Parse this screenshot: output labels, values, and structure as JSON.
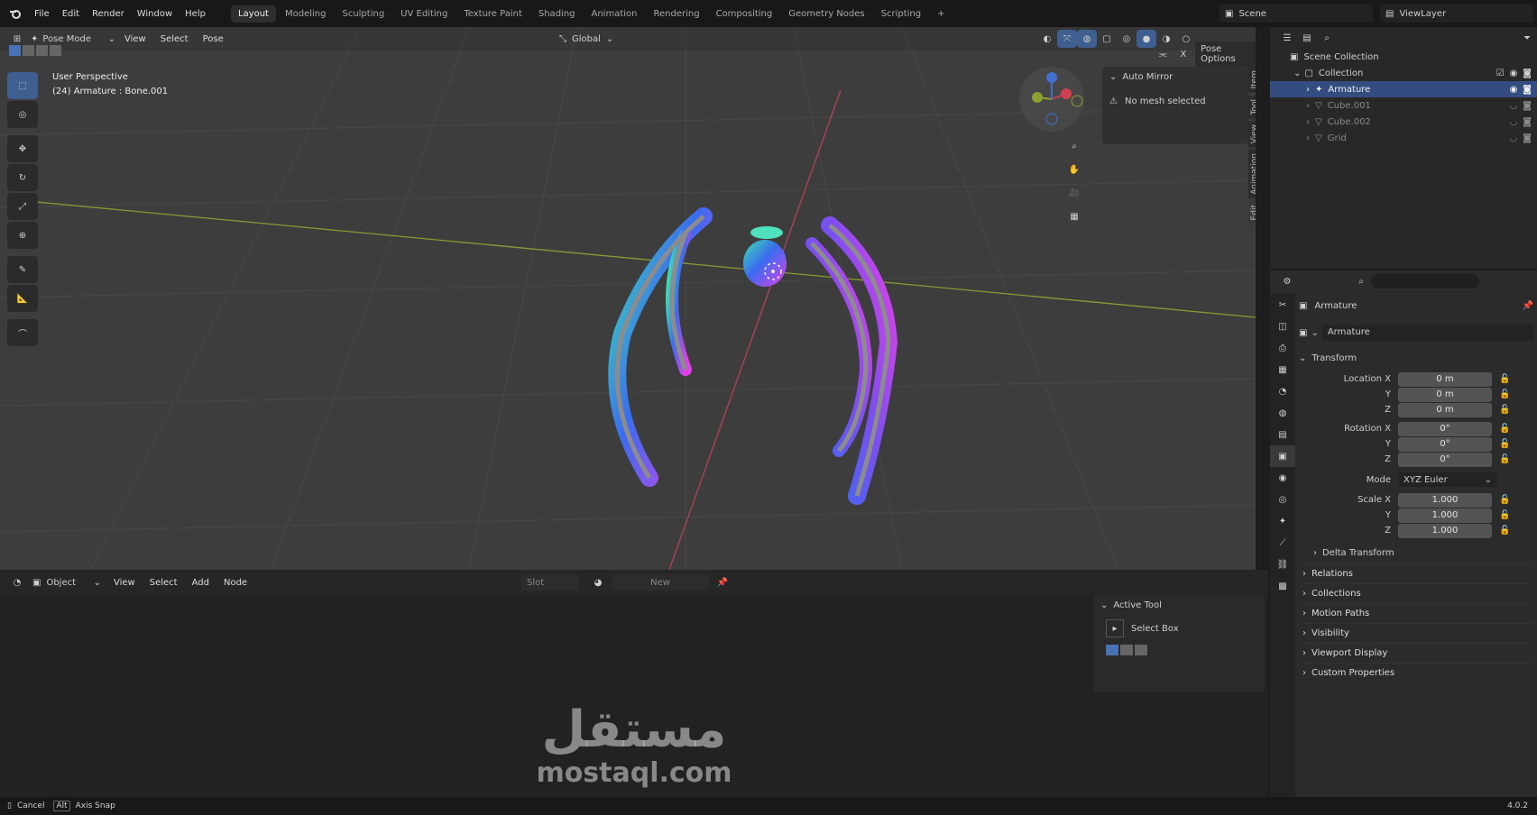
{
  "app": {
    "version": "4.0.2"
  },
  "topbar": {
    "menus": [
      "File",
      "Edit",
      "Render",
      "Window",
      "Help"
    ],
    "workspaces": [
      "Layout",
      "Modeling",
      "Sculpting",
      "UV Editing",
      "Texture Paint",
      "Shading",
      "Animation",
      "Rendering",
      "Compositing",
      "Geometry Nodes",
      "Scripting"
    ],
    "active_workspace": "Layout",
    "scene": "Scene",
    "view_layer": "ViewLayer"
  },
  "viewport": {
    "mode": "Pose Mode",
    "menus": [
      "View",
      "Select",
      "Pose"
    ],
    "orientation": "Global",
    "overlay_title": "User Perspective",
    "overlay_sub": "(24) Armature : Bone.001",
    "pose_options": "Pose Options",
    "auto_mirror": "Auto Mirror",
    "no_mesh": "No mesh selected",
    "side_tabs": [
      "Item",
      "Tool",
      "View",
      "Animation",
      "Edit"
    ]
  },
  "bottom_editor": {
    "object": "Object",
    "menus": [
      "View",
      "Select",
      "Add",
      "Node"
    ],
    "slot": "Slot",
    "new": "New",
    "active_tool": "Active Tool",
    "select_box": "Select Box"
  },
  "status": {
    "cancel": "Cancel",
    "alt": "Alt",
    "axis_snap": "Axis Snap"
  },
  "outliner": {
    "scene_collection": "Scene Collection",
    "collection": "Collection",
    "items": [
      "Armature",
      "Cube.001",
      "Cube.002",
      "Grid"
    ]
  },
  "properties": {
    "object_name": "Armature",
    "data_name": "Armature",
    "transform": "Transform",
    "location_label": "Location X",
    "location": [
      "0 m",
      "0 m",
      "0 m"
    ],
    "rotation_label": "Rotation X",
    "rotation": [
      "0°",
      "0°",
      "0°"
    ],
    "mode_label": "Mode",
    "mode_value": "XYZ Euler",
    "scale_label": "Scale X",
    "scale": [
      "1.000",
      "1.000",
      "1.000"
    ],
    "axis_y": "Y",
    "axis_z": "Z",
    "delta": "Delta Transform",
    "sections": [
      "Relations",
      "Collections",
      "Motion Paths",
      "Visibility",
      "Viewport Display",
      "Custom Properties"
    ]
  },
  "watermark": {
    "arabic": "مستقل",
    "latin": "mostaql.com"
  },
  "colors": {
    "accent": "#4772b3",
    "selected_row": "#334d80",
    "viewport_bg": "#3d3d3d"
  }
}
